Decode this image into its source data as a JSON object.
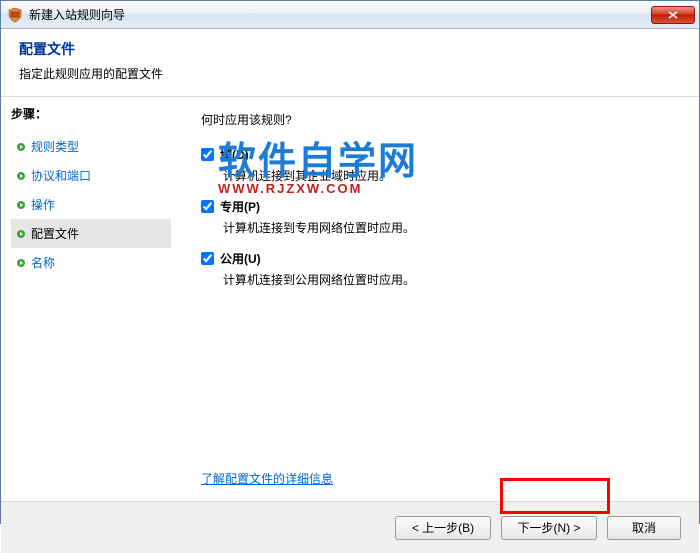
{
  "titlebar": {
    "title": "新建入站规则向导"
  },
  "header": {
    "title": "配置文件",
    "subtitle": "指定此规则应用的配置文件"
  },
  "sidebar": {
    "steps_label": "步骤：",
    "items": [
      {
        "label": "规则类型",
        "current": false
      },
      {
        "label": "协议和端口",
        "current": false
      },
      {
        "label": "操作",
        "current": false
      },
      {
        "label": "配置文件",
        "current": true
      },
      {
        "label": "名称",
        "current": false
      }
    ]
  },
  "content": {
    "question": "何时应用该规则?",
    "options": [
      {
        "label": "域(D)",
        "desc": "计算机连接到其企业域时应用。",
        "checked": true
      },
      {
        "label": "专用(P)",
        "desc": "计算机连接到专用网络位置时应用。",
        "checked": true
      },
      {
        "label": "公用(U)",
        "desc": "计算机连接到公用网络位置时应用。",
        "checked": true
      }
    ],
    "learn_more": "了解配置文件的详细信息"
  },
  "footer": {
    "back": "< 上一步(B)",
    "next": "下一步(N) >",
    "cancel": "取消"
  },
  "watermark": {
    "main": "软件自学网",
    "sub": "WWW.RJZXW.COM"
  }
}
